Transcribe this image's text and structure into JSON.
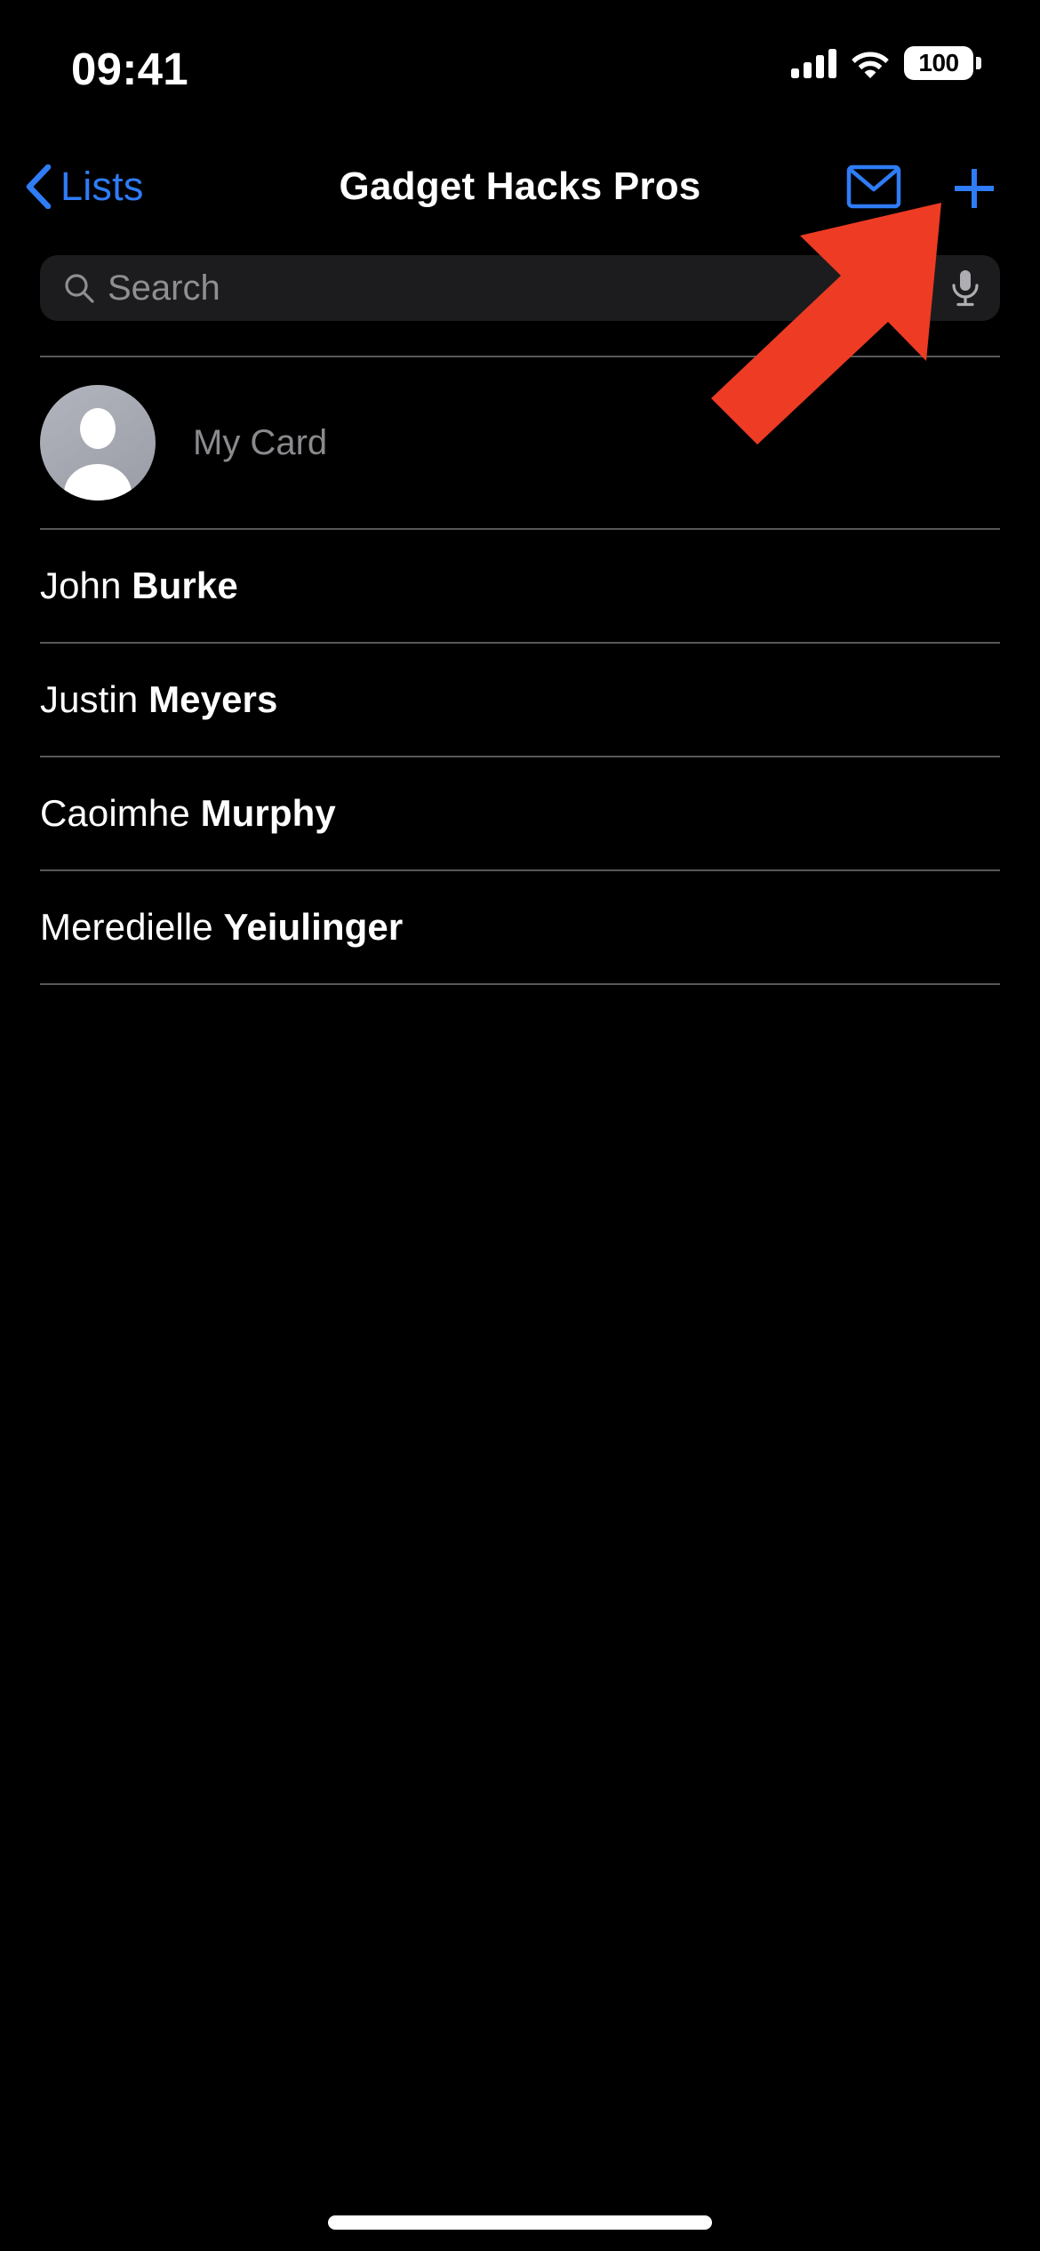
{
  "status_bar": {
    "time": "09:41",
    "signal_icon": "cellular-bars-icon",
    "wifi_icon": "wifi-icon",
    "battery_icon": "battery-icon",
    "battery_level": "100"
  },
  "nav_bar": {
    "back_label": "Lists",
    "back_icon": "chevron-left-icon",
    "title": "Gadget Hacks Pros",
    "mail_icon": "envelope-icon",
    "add_icon": "plus-icon"
  },
  "search": {
    "placeholder": "Search",
    "value": "",
    "search_icon": "magnifying-glass-icon",
    "mic_icon": "microphone-icon"
  },
  "my_card": {
    "label": "My Card",
    "avatar_icon": "person-avatar-icon"
  },
  "contacts": [
    {
      "first": "John ",
      "last": "Burke"
    },
    {
      "first": "Justin ",
      "last": "Meyers"
    },
    {
      "first": "Caoimhe ",
      "last": "Murphy"
    },
    {
      "first": "Meredielle ",
      "last": "Yeiulinger"
    }
  ],
  "annotation": {
    "type": "arrow",
    "color": "#ee3b24",
    "points_to": "add-button"
  },
  "colors": {
    "background": "#000000",
    "accent_blue": "#2f7cf6",
    "search_field": "#1c1c1e",
    "secondary_text": "#8e8e93",
    "divider": "#58585b",
    "annotation_red": "#ee3b24",
    "avatar_gray": "#a8abb4"
  },
  "home_indicator": "home-indicator"
}
